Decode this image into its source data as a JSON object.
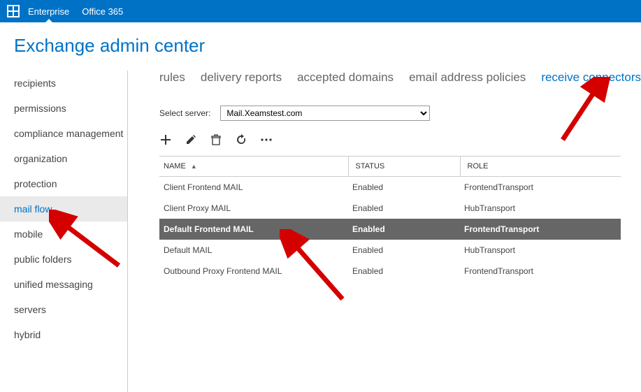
{
  "topbar": {
    "links": [
      "Enterprise",
      "Office 365"
    ],
    "active": 0
  },
  "page_title": "Exchange admin center",
  "sidebar": {
    "items": [
      "recipients",
      "permissions",
      "compliance management",
      "organization",
      "protection",
      "mail flow",
      "mobile",
      "public folders",
      "unified messaging",
      "servers",
      "hybrid"
    ],
    "active": 5
  },
  "tabs": {
    "items": [
      "rules",
      "delivery reports",
      "accepted domains",
      "email address policies",
      "receive connectors"
    ],
    "active": 4
  },
  "server_select": {
    "label": "Select server:",
    "value": "Mail.Xeamstest.com"
  },
  "toolbar": {
    "add": "add",
    "edit": "edit",
    "delete": "delete",
    "refresh": "refresh",
    "more": "more"
  },
  "columns": {
    "name": "NAME",
    "status": "STATUS",
    "role": "ROLE"
  },
  "rows": [
    {
      "name": "Client Frontend MAIL",
      "status": "Enabled",
      "role": "FrontendTransport",
      "selected": false
    },
    {
      "name": "Client Proxy MAIL",
      "status": "Enabled",
      "role": "HubTransport",
      "selected": false
    },
    {
      "name": "Default Frontend MAIL",
      "status": "Enabled",
      "role": "FrontendTransport",
      "selected": true
    },
    {
      "name": "Default MAIL",
      "status": "Enabled",
      "role": "HubTransport",
      "selected": false
    },
    {
      "name": "Outbound Proxy Frontend MAIL",
      "status": "Enabled",
      "role": "FrontendTransport",
      "selected": false
    }
  ]
}
